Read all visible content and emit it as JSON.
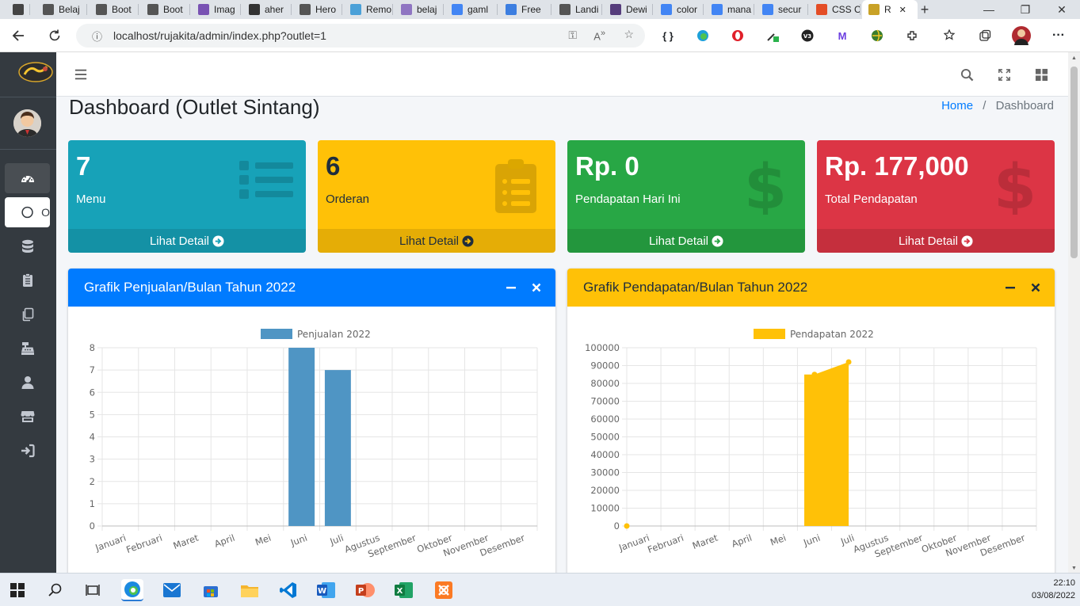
{
  "browser": {
    "tabs": [
      {
        "label": "",
        "fav": "sidebar-icon",
        "color": "#444"
      },
      {
        "label": "Belaj",
        "fav": "edge-page-icon",
        "color": "#555"
      },
      {
        "label": "Boot",
        "fav": "page-icon",
        "color": "#555"
      },
      {
        "label": "Boot",
        "fav": "page-icon",
        "color": "#555"
      },
      {
        "label": "Imag",
        "fav": "bootstrap-icon",
        "color": "#7952b3"
      },
      {
        "label": "aher",
        "fav": "github-icon",
        "color": "#333"
      },
      {
        "label": "Hero",
        "fav": "page-icon",
        "color": "#555"
      },
      {
        "label": "Remo",
        "fav": "remove-icon",
        "color": "#4aa0d8"
      },
      {
        "label": "belaj",
        "fav": "heroku-icon",
        "color": "#8f75c2"
      },
      {
        "label": "gaml",
        "fav": "google-icon",
        "color": "#4285f4"
      },
      {
        "label": "Free",
        "fav": "free-icon",
        "color": "#3c7ee0"
      },
      {
        "label": "Landi",
        "fav": "page-icon",
        "color": "#555"
      },
      {
        "label": "Dewi",
        "fav": "bootstrap-icon",
        "color": "#563d7c"
      },
      {
        "label": "color",
        "fav": "google-icon",
        "color": "#4285f4"
      },
      {
        "label": "mana",
        "fav": "google-icon",
        "color": "#4285f4"
      },
      {
        "label": "secur",
        "fav": "google-icon",
        "color": "#4285f4"
      },
      {
        "label": "CSS C",
        "fav": "css-icon",
        "color": "#e44d26"
      },
      {
        "label": "R",
        "fav": "rujakita-icon",
        "color": "#c9a227"
      }
    ],
    "url": "localhost/rujakita/admin/index.php?outlet=1"
  },
  "header": {
    "page_title": "Dashboard (Outlet Sintang)",
    "breadcrumb_home": "Home",
    "breadcrumb_sep": "/",
    "breadcrumb_current": "Dashboard"
  },
  "sidebar": {
    "submenu_letter": "O"
  },
  "stats": [
    {
      "value": "7",
      "label": "Menu",
      "link": "Lihat Detail",
      "color": "#17a2b8",
      "icon": "list-icon"
    },
    {
      "value": "6",
      "label": "Orderan",
      "link": "Lihat Detail",
      "color": "#ffc107",
      "icon": "clipboard-list-icon"
    },
    {
      "value": "Rp. 0",
      "label": "Pendapatan Hari Ini",
      "link": "Lihat Detail",
      "color": "#28a745",
      "icon": "dollar-icon"
    },
    {
      "value": "Rp. 177,000",
      "label": "Total Pendapatan",
      "link": "Lihat Detail",
      "color": "#dc3545",
      "icon": "dollar-icon"
    }
  ],
  "cards": [
    {
      "title": "Grafik Penjualan/Bulan Tahun 2022",
      "color": "#007bff"
    },
    {
      "title": "Grafik Pendapatan/Bulan Tahun 2022",
      "color": "#ffc107"
    }
  ],
  "chart_data": [
    {
      "type": "bar",
      "categories": [
        "Januari",
        "Februari",
        "Maret",
        "April",
        "Mei",
        "Juni",
        "Juli",
        "Agustus",
        "September",
        "Oktober",
        "November",
        "Desember"
      ],
      "series": [
        {
          "name": "Penjualan 2022",
          "values": [
            0,
            0,
            0,
            0,
            0,
            8,
            7,
            0,
            0,
            0,
            0,
            0
          ],
          "color": "#4f95c4"
        }
      ],
      "ylim": [
        0,
        8
      ],
      "yticks": [
        0,
        1,
        2,
        3,
        4,
        5,
        6,
        7,
        8
      ],
      "grid": true,
      "legend": "top-center"
    },
    {
      "type": "area",
      "categories": [
        "Januari",
        "Februari",
        "Maret",
        "April",
        "Mei",
        "Juni",
        "Juli",
        "Agustus",
        "September",
        "Oktober",
        "November",
        "Desember"
      ],
      "series": [
        {
          "name": "Pendapatan 2022",
          "values": [
            0,
            null,
            null,
            null,
            null,
            85000,
            92000,
            null,
            null,
            null,
            null,
            null
          ],
          "color": "#ffc107"
        }
      ],
      "ylim": [
        0,
        100000
      ],
      "yticks": [
        0,
        10000,
        20000,
        30000,
        40000,
        50000,
        60000,
        70000,
        80000,
        90000,
        100000
      ],
      "grid": true,
      "legend": "top-center"
    }
  ],
  "taskbar": {
    "time": "22:10",
    "date": "03/08/2022"
  }
}
